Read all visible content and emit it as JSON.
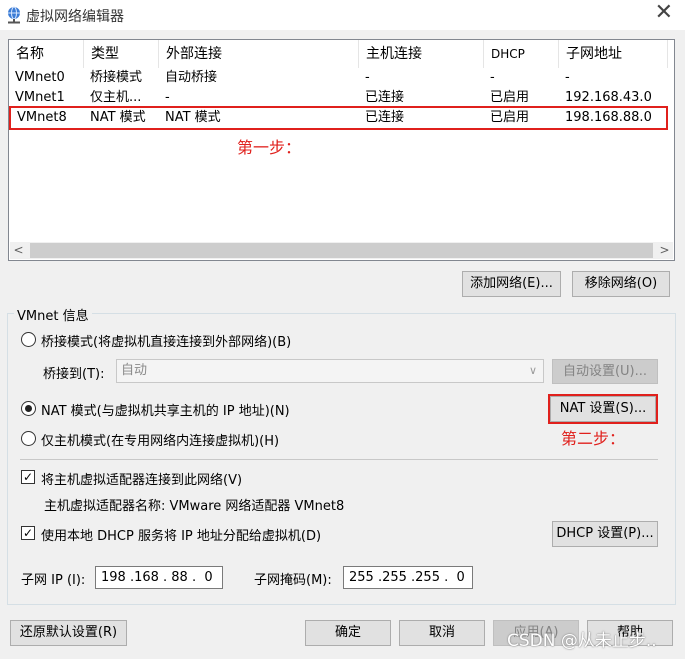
{
  "window": {
    "title": "虚拟网络编辑器",
    "close_glyph": "✕"
  },
  "list": {
    "columns": [
      "名称",
      "类型",
      "外部连接",
      "主机连接",
      "DHCP",
      "子网地址"
    ],
    "rows": [
      [
        "VMnet0",
        "桥接模式",
        "自动桥接",
        "-",
        "-",
        "-"
      ],
      [
        "VMnet1",
        "仅主机...",
        "-",
        "已连接",
        "已启用",
        "192.168.43.0"
      ],
      [
        "VMnet8",
        "NAT 模式",
        "NAT 模式",
        "已连接",
        "已启用",
        "198.168.88.0"
      ]
    ],
    "selected_index": 2,
    "annotation_step1": "第一步：",
    "scroll_left": "<",
    "scroll_right": ">"
  },
  "list_buttons": {
    "add": "添加网络(E)...",
    "remove": "移除网络(O)"
  },
  "vmnet_info": {
    "group_label": "VMnet 信息",
    "bridge_mode": "桥接模式(将虚拟机直接连接到外部网络)(B)",
    "bridge_to_label": "桥接到(T):",
    "bridge_to_value": "自动",
    "auto_settings": "自动设置(U)...",
    "nat_mode": "NAT 模式(与虚拟机共享主机的 IP 地址)(N)",
    "nat_settings": "NAT 设置(S)...",
    "annotation_step2": "第二步：",
    "host_only_mode": "仅主机模式(在专用网络内连接虚拟机)(H)",
    "connect_adapter": "将主机虚拟适配器连接到此网络(V)",
    "adapter_name": "主机虚拟适配器名称: VMware 网络适配器 VMnet8",
    "use_dhcp": "使用本地 DHCP 服务将 IP 地址分配给虚拟机(D)",
    "dhcp_settings": "DHCP 设置(P)...",
    "subnet_ip_label": "子网 IP (I):",
    "subnet_ip_value": "198 .168 . 88 .  0",
    "subnet_mask_label": "子网掩码(M):",
    "subnet_mask_value": "255 .255 .255 .  0",
    "selected_mode": "nat",
    "connect_adapter_checked": true,
    "use_dhcp_checked": true
  },
  "footer": {
    "restore_defaults": "还原默认设置(R)",
    "ok": "确定",
    "cancel": "取消",
    "apply": "应用(A)",
    "help": "帮助"
  },
  "watermark": "CSDN @从未止步..",
  "colors": {
    "annotation_red": "#e0201c",
    "window_bg": "#f0f0f0"
  }
}
